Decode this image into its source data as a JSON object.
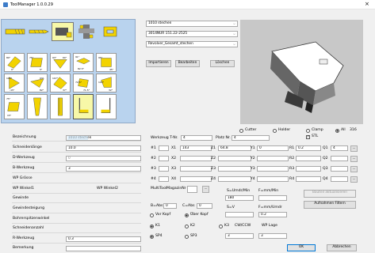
{
  "window": {
    "title": "ToolManager 1.0.0.29"
  },
  "colors": {
    "selected_tile": "#f7f8a8",
    "tile_bg": "#ffffff",
    "palette_bg": "#b9d3ee",
    "tool_yellow": "#f2d300",
    "highlight_field": "#cce4f7"
  },
  "palette": {
    "row1": [
      {
        "icon": "endmill-icon"
      },
      {
        "icon": "drill-icon"
      },
      {
        "icon": "turning-holder-icon"
      },
      {
        "icon": "multi-tool-icon"
      },
      {
        "icon": "yellow-insert-icon"
      }
    ],
    "rows": [
      {
        "tiles": [
          {
            "a": "80°",
            "b": "0°"
          },
          {
            "a": "75°",
            "b": "5°"
          },
          {
            "a": "93°",
            "b": "60°"
          },
          {
            "a": "91°",
            "b": "82.5°"
          },
          {
            "a": "95°",
            "b": "45°"
          }
        ]
      },
      {
        "tiles": [
          {
            "a": "105°",
            "b": "-15°"
          },
          {
            "a": "93°",
            "b": "82°"
          },
          {
            "a": "107°",
            "b": "37°"
          },
          {
            "a": "72.5°",
            "b": "71.5°"
          },
          {
            "a": "105°",
            "b": "32°"
          }
        ]
      },
      {
        "tiles": [
          {
            "a": "75°",
            "b": "15°"
          },
          {
            "a": "",
            "b": ""
          },
          {
            "a": "",
            "b": ""
          },
          {
            "a": "",
            "b": ""
          },
          {
            "a": "",
            "b": ""
          }
        ]
      }
    ]
  },
  "selectors": {
    "tool": "1010 stechen",
    "holder": "3014NUR 151.22-2525",
    "magazine": "Revolver_Gesamt_stechen"
  },
  "buttons": {
    "import": "Importieren",
    "edit": "Bearbeiten",
    "delete": "Löschen",
    "calc_tools": "Bauteil aktualisieren",
    "filter": "Aufnahmen Filtern",
    "ok": "OK",
    "cancel": "Abbrechen",
    "more": "..."
  },
  "filter": {
    "cutter": "Cutter",
    "holder": "Holder",
    "clamp": "Clamp",
    "all": "All",
    "count": "316",
    "stl": "STL"
  },
  "form": {
    "bezeichnung": {
      "label": "Bezeichnung",
      "value": "1010 stechen"
    },
    "schneidenlaenge": {
      "label": "Schneidenlänge",
      "value": "10.0"
    },
    "d_werkzeug": {
      "label": "D-Werkzeug",
      "value": "0"
    },
    "b_werkzeug": {
      "label": "B-Werkzeug",
      "value": "3"
    },
    "wp_groesse": {
      "label": "WP Grösse"
    },
    "wp_winkel1": {
      "label": "WP Winkel1",
      "label2": "WP Winkel2"
    },
    "gewinde": {
      "label": "Gewinde"
    },
    "gewindesteigung": {
      "label": "Gewindesteigung"
    },
    "bohrerspitzenwinkel": {
      "label": "Bohrerspitzenwinkel"
    },
    "schneidenanzahl": {
      "label": "Schneidenanzahl"
    },
    "r_werkzeug": {
      "label": "R-Werkzeug",
      "value": "0.3"
    },
    "bemerkung": {
      "label": "Bemerkung"
    }
  },
  "werkzeug": {
    "label": "Werkzeug T-Nr.",
    "value": "4",
    "platz_label": "Platz Nr.",
    "platz_value": "4"
  },
  "offsets": [
    {
      "n": "#1",
      "x": "143",
      "z": "64.8",
      "y": "0",
      "r": "0.2",
      "q": "4"
    },
    {
      "n": "#2",
      "x": "",
      "z": "",
      "y": "",
      "r": "",
      "q": ""
    },
    {
      "n": "#3",
      "x": "",
      "z": "",
      "y": "",
      "r": "",
      "q": ""
    },
    {
      "n": "#4",
      "x": "",
      "z": "",
      "y": "",
      "r": "",
      "q": ""
    }
  ],
  "labels": {
    "x1": "X1",
    "x2": "X2",
    "x3": "X3",
    "x4": "X4",
    "z1": "Z1",
    "z2": "Z2",
    "z3": "Z3",
    "z4": "Z4",
    "y1": "Y1",
    "y2": "Y2",
    "y3": "Y3",
    "y4": "Y4",
    "r1": "R1",
    "r2": "R2",
    "r3": "R3",
    "r4": "R4",
    "q1": "Q1",
    "q2": "Q2",
    "q3": "Q3",
    "q4": "Q4"
  },
  "multi": {
    "label": "MultiToolMagazinNr",
    "s_label": "S=Umdr/Min",
    "f_label": "F=mm/Min",
    "s_value": "180",
    "babs_label": "B=Abs",
    "babs_value": "0",
    "cabs_label": "C=Abs",
    "cabs_value": "0",
    "sv_label": "S=V",
    "fu_label": "F=mm/Umdr",
    "fu_value": "0.2"
  },
  "kopf": {
    "vor": "Vor Kopf",
    "ueber": "Über Kopf"
  },
  "kanal": {
    "k1": "K1",
    "k2": "K2",
    "k3": "K3",
    "cw": "CW/CCW",
    "wp": "WP Lage",
    "cw_value": "3",
    "wp_value": "3"
  },
  "sp": {
    "sp4": "SP4",
    "sp3": "SP3"
  }
}
